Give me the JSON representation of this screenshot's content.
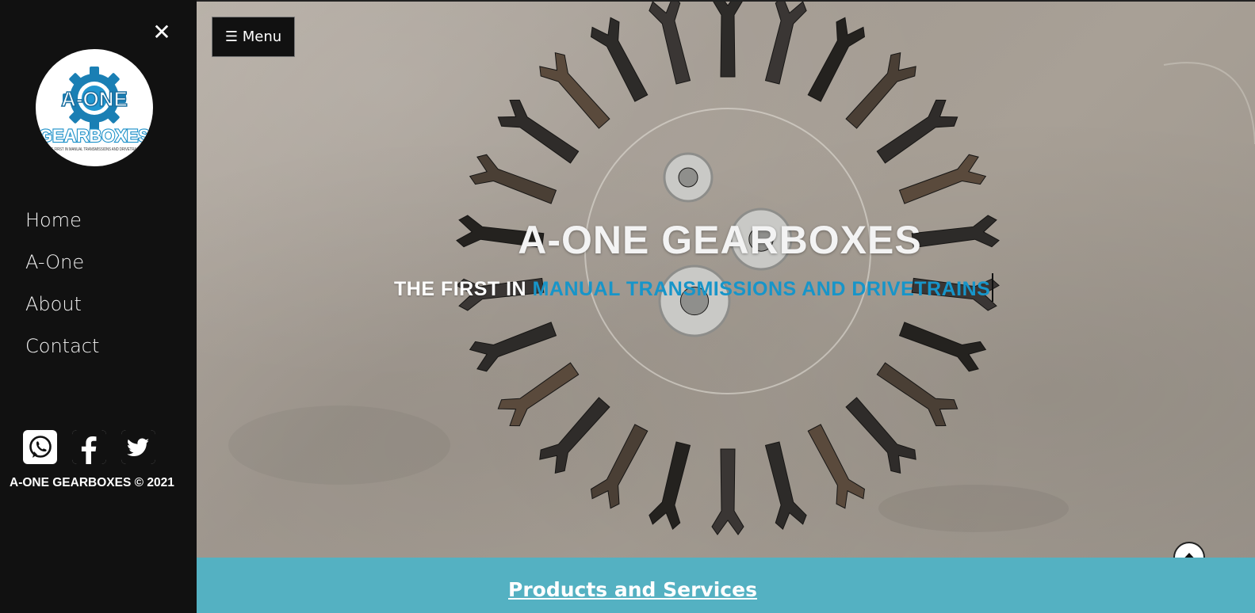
{
  "sidebar": {
    "close_glyph": "✕",
    "logo": {
      "name": "A-ONE",
      "wordmark": "GEARBOXES",
      "tagline": "THE FIRST IN MANUAL TRANSMISSIONS AND DRIVETRAINS"
    },
    "nav": [
      {
        "label": "Home"
      },
      {
        "label": "A-One"
      },
      {
        "label": "About"
      },
      {
        "label": "Contact"
      }
    ],
    "socials": [
      {
        "icon": "whatsapp-icon"
      },
      {
        "icon": "facebook-icon"
      },
      {
        "icon": "twitter-icon"
      }
    ],
    "copyright": "A-ONE GEARBOXES © 2021"
  },
  "hero": {
    "menu_label": "☰ Menu",
    "title": "A-ONE GEARBOXES",
    "subtitle_white": "THE FIRST IN ",
    "subtitle_blue": "MANUAL TRANSMISSIONS AND DRIVETRAINS"
  },
  "products": {
    "link_label": "Products and Services"
  },
  "colors": {
    "sidebar_bg": "#111111",
    "accent_blue": "#1795c9",
    "band_teal": "#54b1c2"
  }
}
